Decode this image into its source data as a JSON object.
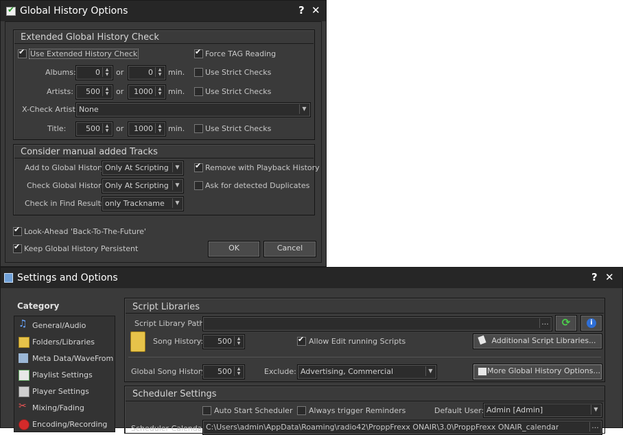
{
  "dialog": {
    "title": "Global History Options",
    "help": "?",
    "close": "✕",
    "extended": {
      "title": "Extended Global History Check",
      "use_extended": "Use Extended History Check",
      "force_tag": "Force TAG Reading",
      "albums_label": "Albums:",
      "albums_a": "0",
      "albums_b": "0",
      "artists_label": "Artists:",
      "artists_a": "500",
      "artists_b": "1000",
      "xcheck_label": "X-Check Artist:",
      "xcheck_value": "None",
      "title_label": "Title:",
      "title_a": "500",
      "title_b": "1000",
      "or": "or",
      "min": "min.",
      "strict": "Use Strict Checks"
    },
    "manual": {
      "title": "Consider manual added Tracks",
      "add_label": "Add to Global History:",
      "add_value": "Only At Scripting",
      "check_label": "Check Global History:",
      "check_value": "Only At Scripting",
      "find_label": "Check in Find Results:",
      "find_value": "only Trackname",
      "remove_playback": "Remove with Playback History",
      "ask_duplicates": "Ask for detected Duplicates"
    },
    "look_ahead": "Look-Ahead 'Back-To-The-Future'",
    "keep_persistent": "Keep Global History Persistent",
    "ok": "OK",
    "cancel": "Cancel"
  },
  "settings": {
    "title": "Settings and Options",
    "help": "?",
    "close": "✕",
    "category_title": "Category",
    "categories": [
      {
        "label": "General/Audio",
        "icon": "music-note-icon"
      },
      {
        "label": "Folders/Libraries",
        "icon": "folder-icon"
      },
      {
        "label": "Meta Data/WaveFrom",
        "icon": "waveform-icon"
      },
      {
        "label": "Playlist Settings",
        "icon": "playlist-icon"
      },
      {
        "label": "Player Settings",
        "icon": "player-icon"
      },
      {
        "label": "Mixing/Fading",
        "icon": "mixing-icon"
      },
      {
        "label": "Encoding/Recording",
        "icon": "record-icon"
      }
    ],
    "script_libraries": {
      "title": "Script Libraries",
      "path_label": "Script Library Path:",
      "path_value": "",
      "browse": "...",
      "song_history_label": "Song History:",
      "song_history_value": "500",
      "allow_edit": "Allow Edit running Scripts",
      "additional": "Additional Script Libraries...",
      "global_song_label": "Global Song History:",
      "global_song_value": "500",
      "exclude_label": "Exclude:",
      "exclude_value": "Advertising, Commercial",
      "more_global": "More Global History Options..."
    },
    "scheduler": {
      "title": "Scheduler Settings",
      "auto_start": "Auto Start Scheduler",
      "always_trigger": "Always trigger Reminders",
      "default_user_label": "Default User:",
      "default_user_value": "Admin [Admin]",
      "calendar_label": "Scheduler Calendar:",
      "calendar_value": "C:\\Users\\admin\\AppData\\Roaming\\radio42\\ProppFrexx ONAIR\\3.0\\ProppFrexx ONAIR_calendar",
      "browse": "..."
    }
  }
}
